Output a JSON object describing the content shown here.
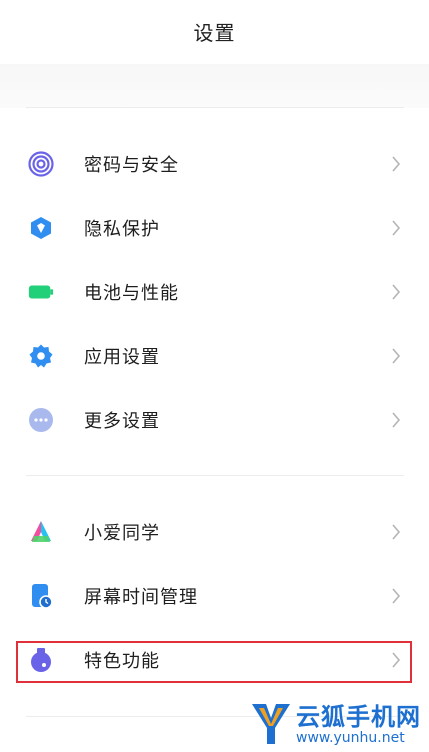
{
  "header": {
    "title": "设置"
  },
  "group1": [
    {
      "label": "密码与安全",
      "icon": "fingerprint-icon"
    },
    {
      "label": "隐私保护",
      "icon": "privacy-shield-icon"
    },
    {
      "label": "电池与性能",
      "icon": "battery-icon"
    },
    {
      "label": "应用设置",
      "icon": "gear-icon"
    },
    {
      "label": "更多设置",
      "icon": "more-dots-icon"
    }
  ],
  "group2": [
    {
      "label": "小爱同学",
      "icon": "xiaoai-icon"
    },
    {
      "label": "屏幕时间管理",
      "icon": "screen-time-icon"
    },
    {
      "label": "特色功能",
      "icon": "flask-icon"
    }
  ],
  "watermark": {
    "text": "云狐手机网",
    "url": "www.yunhu.net"
  },
  "colors": {
    "accent_blue": "#2f8ef0",
    "green": "#22d07a",
    "purple": "#6a63e8",
    "highlight": "#e0303a"
  }
}
